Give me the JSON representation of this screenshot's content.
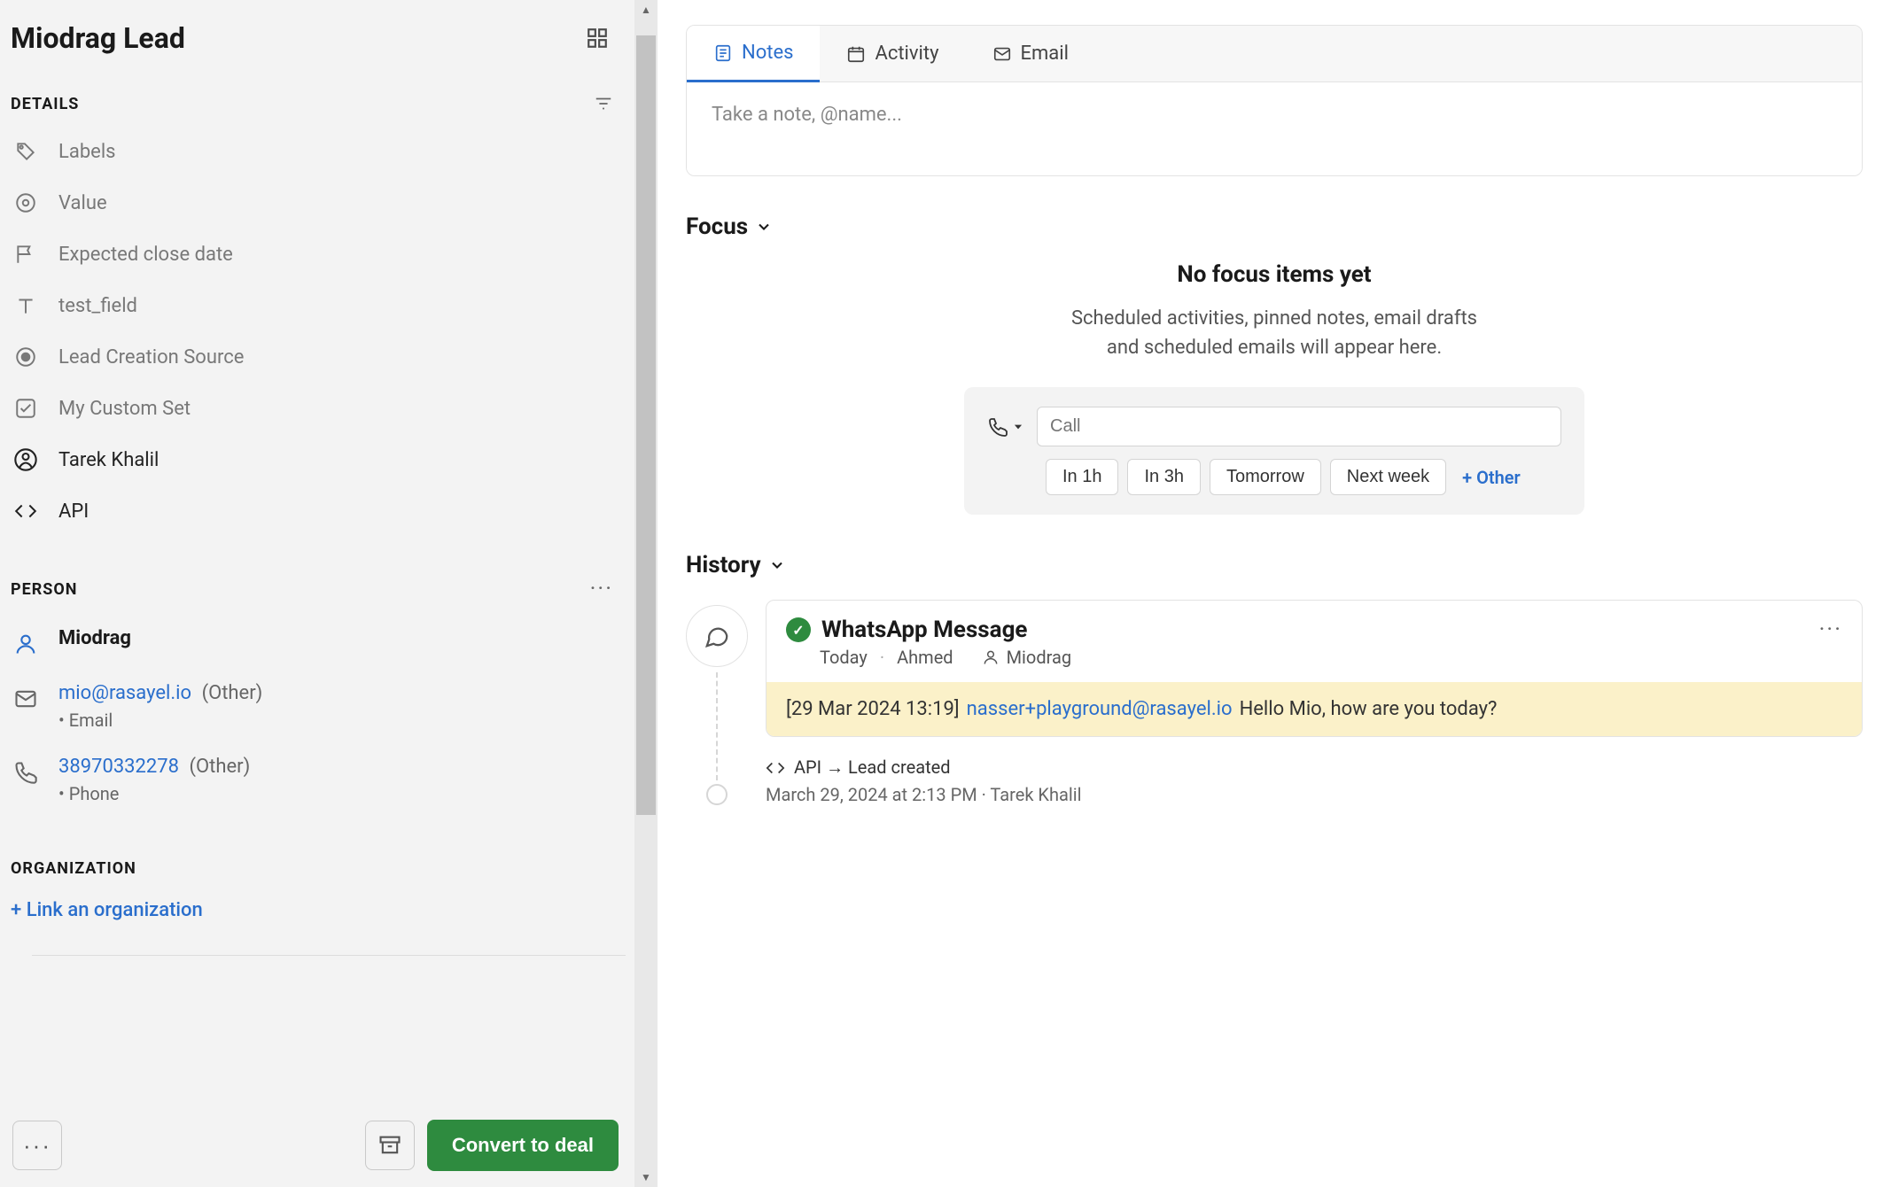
{
  "lead": {
    "title": "Miodrag Lead"
  },
  "sections": {
    "details": "DETAILS",
    "person": "PERSON",
    "organization": "ORGANIZATION"
  },
  "details": {
    "labels": "Labels",
    "value": "Value",
    "expected_close": "Expected close date",
    "test_field": "test_field",
    "lead_source": "Lead Creation Source",
    "custom_set": "My Custom Set",
    "owner": "Tarek Khalil",
    "api": "API"
  },
  "person": {
    "name": "Miodrag",
    "email": "mio@rasayel.io",
    "email_suffix": "(Other)",
    "email_label": "Email",
    "phone": "38970332278",
    "phone_suffix": "(Other)",
    "phone_label": "Phone"
  },
  "organization": {
    "add_link": "Link an organization"
  },
  "footer": {
    "convert": "Convert to deal"
  },
  "tabs": {
    "notes": "Notes",
    "activity": "Activity",
    "email": "Email"
  },
  "note_placeholder": "Take a note, @name...",
  "focus": {
    "heading": "Focus",
    "empty_title": "No focus items yet",
    "empty_body1": "Scheduled activities, pinned notes, email drafts",
    "empty_body2": "and scheduled emails will appear here."
  },
  "scheduler": {
    "placeholder": "Call",
    "chips": [
      "In 1h",
      "In 3h",
      "Tomorrow",
      "Next week"
    ],
    "other": "+ Other"
  },
  "history": {
    "heading": "History",
    "whatsapp": {
      "title": "WhatsApp Message",
      "date": "Today",
      "author": "Ahmed",
      "participant": "Miodrag",
      "body_prefix": "[29 Mar 2024 13:19]",
      "body_link": "nasser+playground@rasayel.io",
      "body_text": "Hello Mio, how are you today?"
    },
    "api_event": {
      "label": "API → Lead created",
      "meta": "March 29, 2024 at 2:13 PM · Tarek Khalil"
    }
  }
}
